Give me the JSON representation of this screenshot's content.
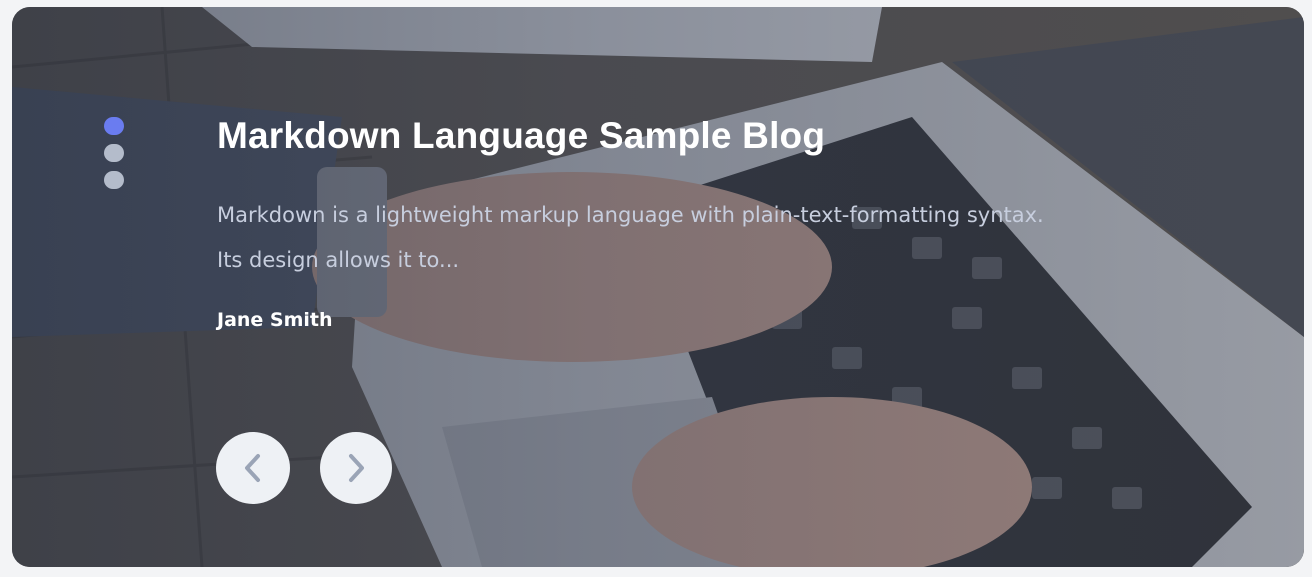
{
  "slider": {
    "title": "Markdown Language Sample Blog",
    "excerpt": "Markdown is a lightweight markup language with plain-text-formatting syntax. Its design allows it to...",
    "author": "Jane Smith",
    "active_slide": 1,
    "slide_count": 3
  },
  "controls": {
    "prev_icon": "chevron-left-icon",
    "next_icon": "chevron-right-icon"
  },
  "colors": {
    "active_dot": "#6a7cf0",
    "inactive_dot": "#b4bccb",
    "button_bg": "#eef1f5",
    "chevron": "#9aa4b6"
  }
}
